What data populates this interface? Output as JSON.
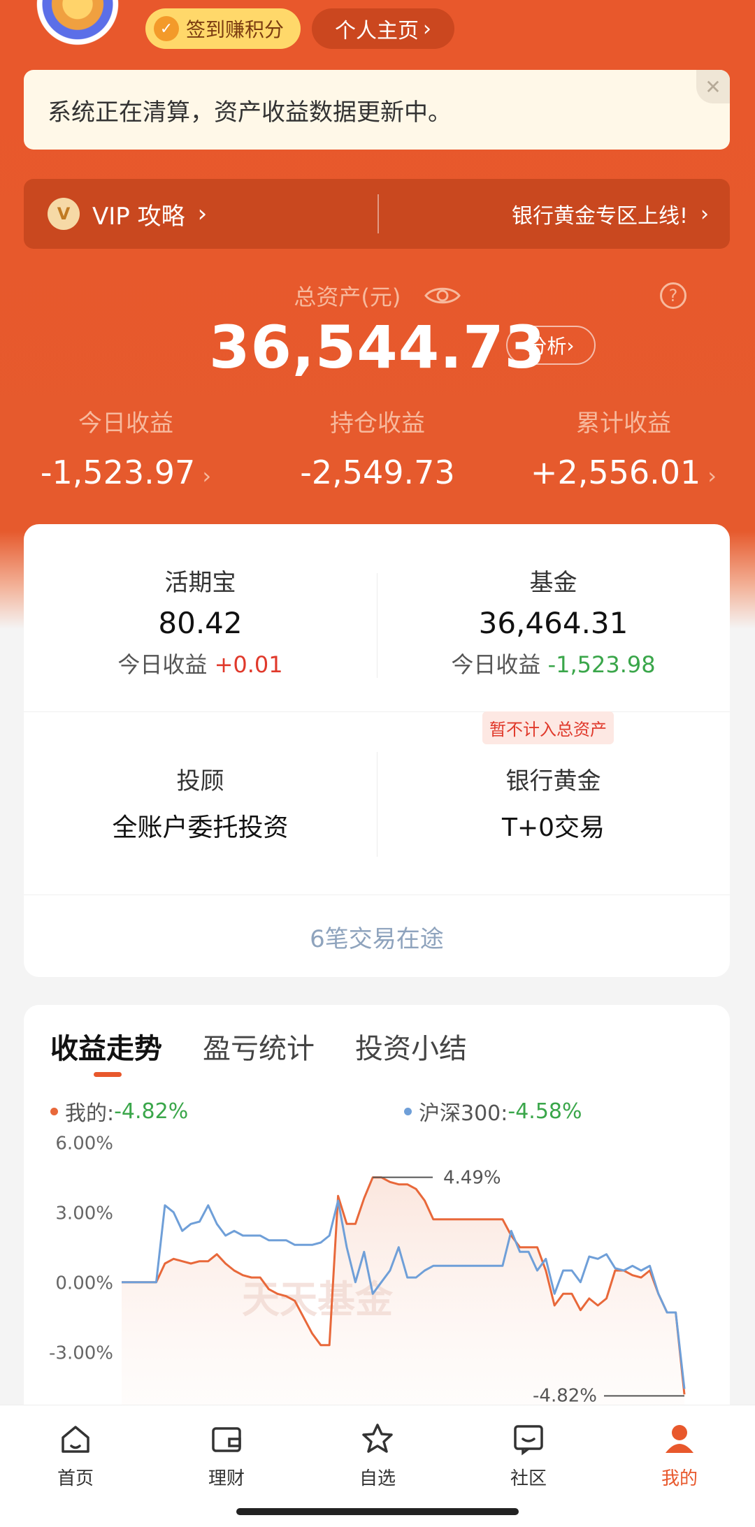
{
  "header": {
    "checkin_label": "签到赚积分",
    "profile_label": "个人主页"
  },
  "notice": {
    "text": "系统正在清算，资产收益数据更新中。"
  },
  "vip_bar": {
    "vip_label": "VIP 攻略",
    "gold_label": "银行黄金专区上线!"
  },
  "assets": {
    "total_label": "总资产(元)",
    "total_value": "36,544.73",
    "analysis_label": "分析",
    "today_label": "今日收益",
    "today_value": "-1,523.97",
    "holding_label": "持仓收益",
    "holding_value": "-2,549.73",
    "cumulative_label": "累计收益",
    "cumulative_value": "+2,556.01"
  },
  "accounts": {
    "huoqibao": {
      "title": "活期宝",
      "value": "80.42",
      "sub_label": "今日收益",
      "sub_value": "+0.01"
    },
    "fund": {
      "title": "基金",
      "value": "36,464.31",
      "sub_label": "今日收益",
      "sub_value": "-1,523.98"
    },
    "gold_tag": "暂不计入总资产",
    "advisor": {
      "title": "投顾",
      "value": "全账户委托投资"
    },
    "bank_gold": {
      "title": "银行黄金",
      "value": "T+0交易"
    },
    "pending": "6笔交易在途"
  },
  "trend": {
    "tabs": [
      "收益走势",
      "盈亏统计",
      "投资小结"
    ],
    "legend_mine_label": "我的:",
    "legend_mine_value": "-4.82%",
    "legend_index_label": "沪深300:",
    "legend_index_value": "-4.58%",
    "colors": {
      "mine": "#e8683a",
      "index": "#6f9fd8",
      "neg": "#3aa64a"
    }
  },
  "chart_data": {
    "type": "line",
    "y_ticks": [
      "6.00%",
      "3.00%",
      "0.00%",
      "-3.00%"
    ],
    "ylim": [
      -5.5,
      6.5
    ],
    "watermark": "天天基金",
    "annotations": [
      "4.49%",
      "-4.82%"
    ],
    "series": [
      {
        "name": "我的",
        "color": "#e8683a",
        "values": [
          0.0,
          0.0,
          0.0,
          0.0,
          0.0,
          0.8,
          1.0,
          0.9,
          0.8,
          0.9,
          0.9,
          1.2,
          0.8,
          0.5,
          0.3,
          0.2,
          0.2,
          -0.3,
          -0.5,
          -0.6,
          -0.8,
          -1.5,
          -2.2,
          -2.7,
          -2.7,
          3.7,
          2.5,
          2.5,
          3.6,
          4.5,
          4.5,
          4.3,
          4.2,
          4.2,
          4.0,
          3.5,
          2.7,
          2.7,
          2.7,
          2.7,
          2.7,
          2.7,
          2.7,
          2.7,
          2.7,
          2.0,
          1.5,
          1.5,
          1.5,
          0.5,
          -1.0,
          -0.5,
          -0.5,
          -1.2,
          -0.7,
          -1.0,
          -0.7,
          0.5,
          0.5,
          0.3,
          0.2,
          0.5,
          -0.5,
          -1.3,
          -1.3,
          -4.82
        ]
      },
      {
        "name": "沪深300",
        "color": "#6f9fd8",
        "values": [
          0.0,
          0.0,
          0.0,
          0.0,
          0.0,
          3.3,
          3.0,
          2.2,
          2.5,
          2.6,
          3.3,
          2.5,
          2.0,
          2.2,
          2.0,
          2.0,
          2.0,
          1.8,
          1.8,
          1.8,
          1.6,
          1.6,
          1.6,
          1.7,
          2.0,
          3.5,
          1.5,
          0.0,
          1.3,
          -0.5,
          0.0,
          0.5,
          1.5,
          0.2,
          0.2,
          0.5,
          0.7,
          0.7,
          0.7,
          0.7,
          0.7,
          0.7,
          0.7,
          0.7,
          0.7,
          2.2,
          1.3,
          1.3,
          0.5,
          1.0,
          -0.5,
          0.5,
          0.5,
          0.0,
          1.1,
          1.0,
          1.2,
          0.6,
          0.5,
          0.7,
          0.5,
          0.7,
          -0.5,
          -1.3,
          -1.3,
          -4.58
        ]
      }
    ]
  },
  "nav": {
    "home": "首页",
    "wealth": "理财",
    "watchlist": "自选",
    "community": "社区",
    "mine": "我的"
  }
}
